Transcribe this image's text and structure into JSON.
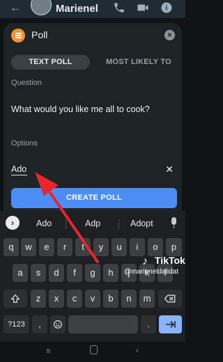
{
  "header": {
    "contact_name": "Marienel"
  },
  "poll": {
    "title": "Poll",
    "tabs": [
      "TEXT POLL",
      "MOST LIKELY TO"
    ],
    "question_label": "Question",
    "question_text": "What would you like me all to cook?",
    "options_label": "Options",
    "option_value": "Ado",
    "create_label": "CREATE POLL"
  },
  "keyboard": {
    "suggestions": [
      "Ado",
      "Adp",
      "Adopt"
    ],
    "row1": [
      "q",
      "w",
      "e",
      "r",
      "t",
      "y",
      "u",
      "i",
      "o",
      "p"
    ],
    "row2": [
      "a",
      "s",
      "d",
      "f",
      "g",
      "h",
      "j",
      "k",
      "l"
    ],
    "row3": [
      "z",
      "x",
      "c",
      "v",
      "b",
      "n",
      "m"
    ],
    "symbols_label": "?123",
    "comma": ",",
    "period": "."
  },
  "watermark": {
    "brand": "TikTok",
    "handle": "@marieneldalidat"
  },
  "colors": {
    "accent": "#4c8df6",
    "poll_icon": "#f29330",
    "header_bg": "#1f2c33",
    "arrow": "#e8262c"
  }
}
